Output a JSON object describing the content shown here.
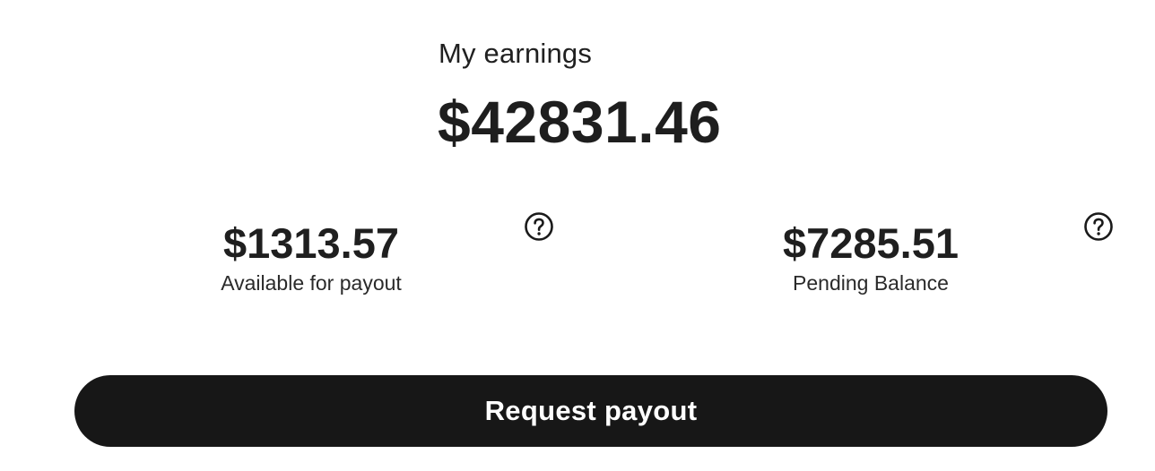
{
  "earnings": {
    "label": "My earnings",
    "total": "$42831.46"
  },
  "available": {
    "amount": "$1313.57",
    "caption": "Available for payout",
    "icon": "question-circle-icon"
  },
  "pending": {
    "amount": "$7285.51",
    "caption": "Pending Balance",
    "icon": "question-circle-icon"
  },
  "actions": {
    "payout_label": "Request payout"
  },
  "colors": {
    "text": "#1f1f1f",
    "button_bg": "#171717",
    "button_text": "#ffffff",
    "background": "#ffffff"
  }
}
